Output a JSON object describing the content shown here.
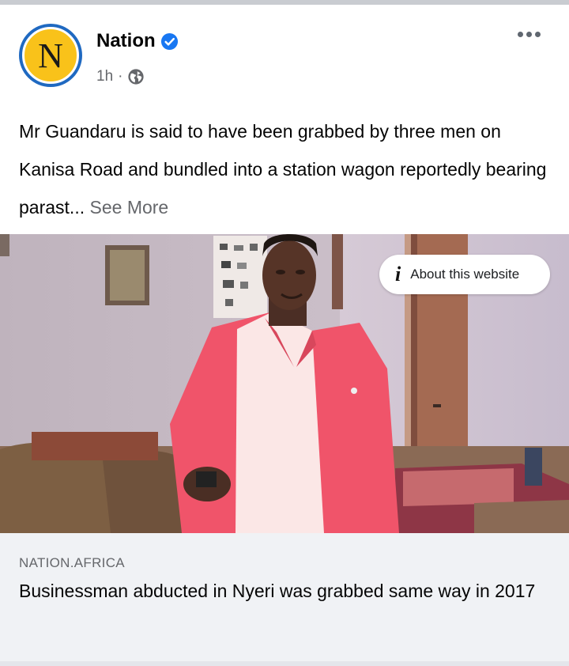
{
  "post": {
    "page_name": "Nation",
    "avatar_letter": "N",
    "time": "1h",
    "separator": "·",
    "text": "Mr Guandaru is said to have been grabbed by three men on Kanisa Road and bundled into a station wagon reportedly bearing parast...",
    "see_more": "See More",
    "icons": [
      "verified-badge-icon",
      "globe-icon",
      "more-options-icon",
      "info-icon"
    ]
  },
  "image": {
    "about_label": "About this website",
    "info_glyph": "i"
  },
  "link": {
    "domain": "NATION.AFRICA",
    "headline": "Businessman abducted in Nyeri was grabbed same way in 2017"
  },
  "colors": {
    "brand_blue": "#1877f2",
    "avatar_yellow": "#f9c21a",
    "secondary_text": "#65676b",
    "link_panel_bg": "#f0f2f5",
    "jacket_pink": "#f0546a"
  }
}
